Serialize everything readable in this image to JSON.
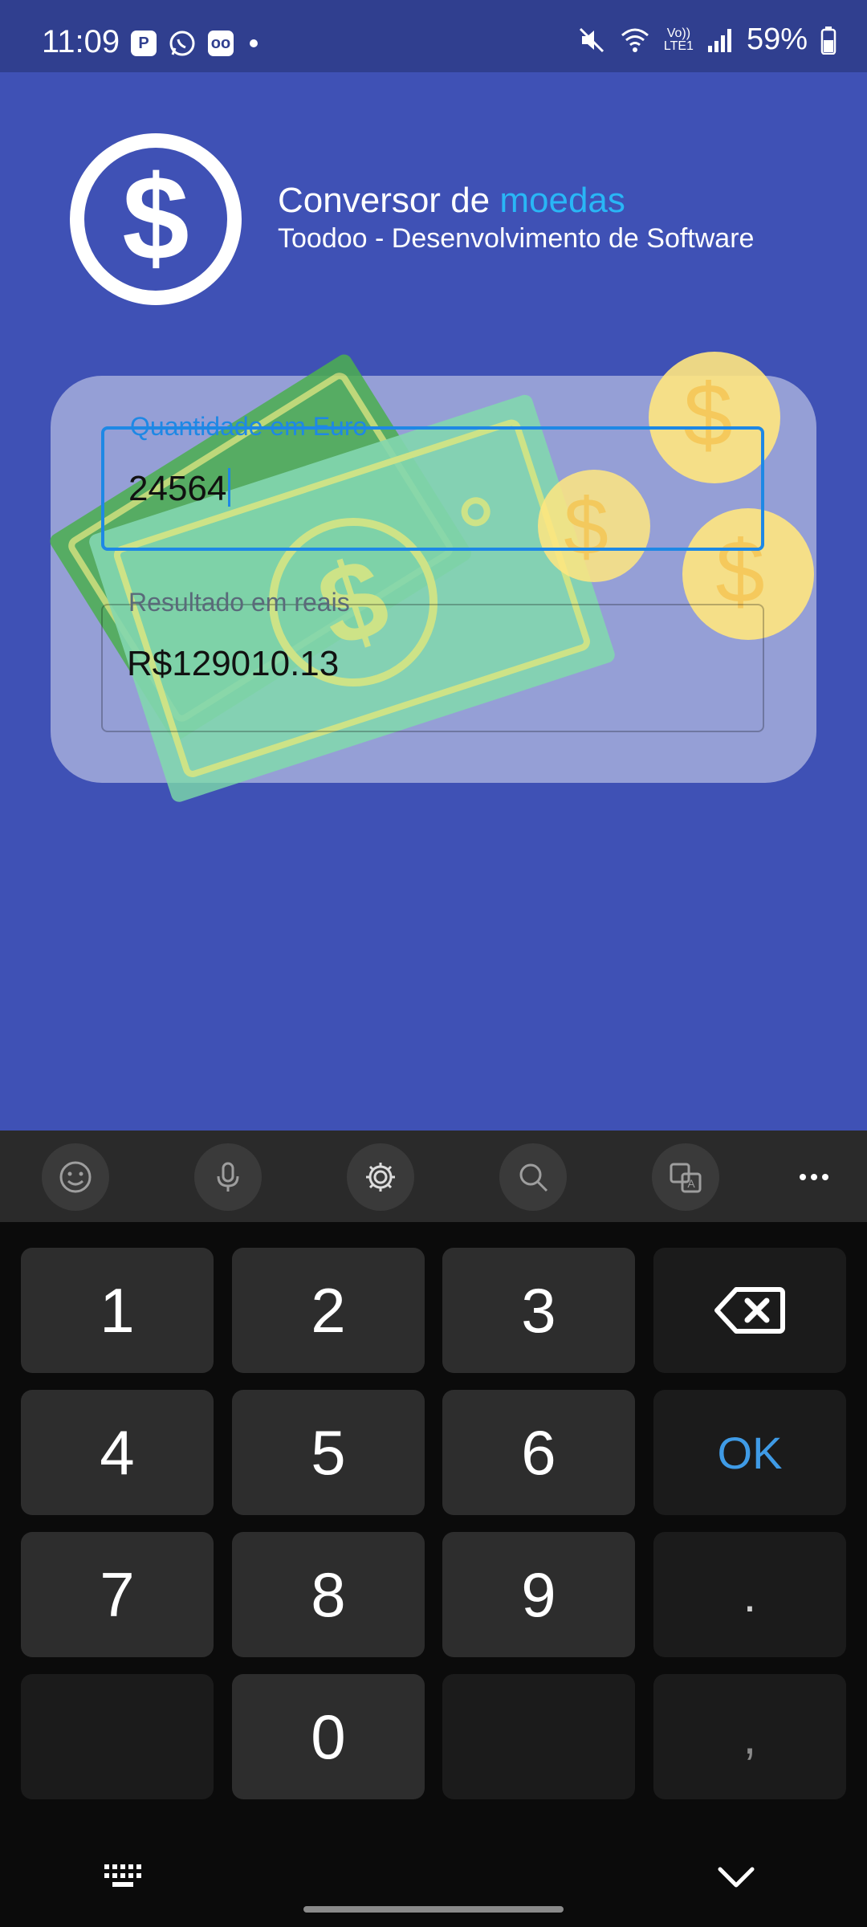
{
  "status_bar": {
    "time": "11:09",
    "battery": "59%",
    "network_label_top": "Vo))",
    "network_label_bottom": "LTE1"
  },
  "app": {
    "title_prefix": "Conversor de ",
    "title_accent": "moedas",
    "subtitle": "Toodoo - Desenvolvimento de Software",
    "accent_color": "#29b6f6"
  },
  "form": {
    "euro_label": "Quantidade em Euro",
    "euro_value": "24564",
    "reais_label": "Resultado em reais",
    "reais_value": "R$129010.13"
  },
  "keyboard": {
    "toolbar": [
      "emoji-icon",
      "mic-icon",
      "settings-icon",
      "search-icon",
      "translate-icon",
      "more-icon"
    ],
    "keys": {
      "k1": "1",
      "k2": "2",
      "k3": "3",
      "k4": "4",
      "k5": "5",
      "k6": "6",
      "k7": "7",
      "k8": "8",
      "k9": "9",
      "k0": "0",
      "ok": "OK",
      "dot": ".",
      "comma": ","
    }
  }
}
